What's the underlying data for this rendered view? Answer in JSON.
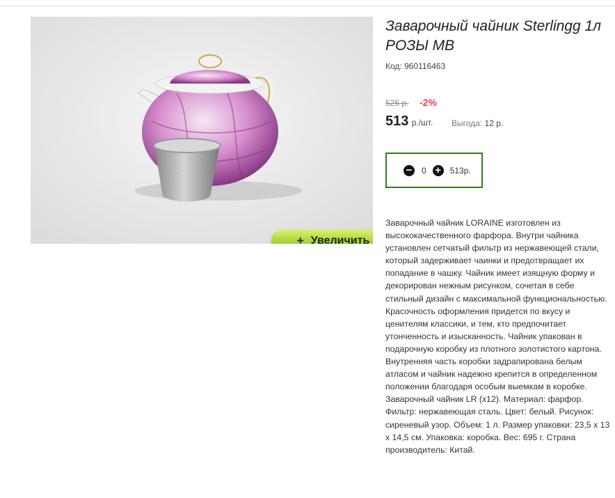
{
  "product": {
    "title": "Заварочный чайник Sterlingg 1л РОЗЫ МВ",
    "sku": "Код: 960116463",
    "zoom_label": "Увеличить",
    "zoom_icon": "plus-icon"
  },
  "pricing": {
    "old_price": "525 р.",
    "discount": "-2%",
    "price": "513",
    "unit": "р./шт.",
    "benefit_label": "Выгода:",
    "benefit_value": "12 р."
  },
  "cart": {
    "quantity": "0",
    "total": "513р.",
    "minus_icon": "minus-circle-icon",
    "plus_icon": "plus-circle-icon"
  },
  "description": "Заварочный чайник LORAINE изготовлен из высококачественного фарфора. Внутри чайника установлен сетчатый фильтр из нержавеющей стали, который задерживает чаинки и предотвращает их попадание в чашку. Чайник имеет изящную форму и декорирован нежным рисунком, сочетая в себе стильный дизайн с максимальной функциональностью. Красочность оформления придется по вкусу и ценителям классики, и тем, кто предпочитает утонченность и изысканность. Чайник упакован в подарочную коробку из плотного золотистого картона. Внутренняя часть коробки задрапирована белым атласом и чайник надежно крепится в определенном положении благодаря особым выемкам в коробке. Заварочный чайник LR (x12). Материал: фарфор. Фильтр: нержавеющая сталь. Цвет: белый. Рисунок: сиреневый узор. Объем: 1 л. Размер упаковки: 23,5 х 13 х 14,5 см. Упаковка: коробка. Вес: 695 г. Страна производитель: Китай.",
  "colors": {
    "accent_green": "#2e7d1d",
    "discount_red": "#e83d4a",
    "button_green": "#a9d23a"
  }
}
